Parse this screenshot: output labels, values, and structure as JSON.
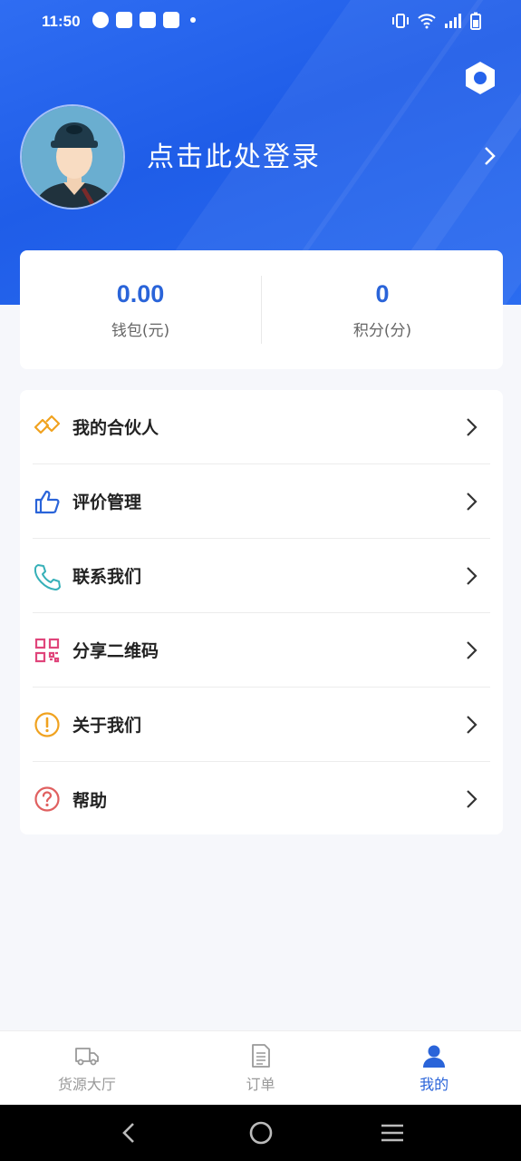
{
  "status_bar": {
    "time": "11:50"
  },
  "header": {
    "login_text": "点击此处登录"
  },
  "stats": [
    {
      "value": "0.00",
      "label": "钱包(元)"
    },
    {
      "value": "0",
      "label": "积分(分)"
    }
  ],
  "menu": [
    {
      "label": "我的合伙人",
      "icon": "partner-icon",
      "color": "#f0a21f"
    },
    {
      "label": "评价管理",
      "icon": "thumb-up-icon",
      "color": "#2a64d9"
    },
    {
      "label": "联系我们",
      "icon": "phone-icon",
      "color": "#36b0b8"
    },
    {
      "label": "分享二维码",
      "icon": "qr-grid-icon",
      "color": "#e0457b"
    },
    {
      "label": "关于我们",
      "icon": "exclamation-circle-icon",
      "color": "#f0a21f"
    },
    {
      "label": "帮助",
      "icon": "question-circle-icon",
      "color": "#e06060"
    }
  ],
  "tabs": [
    {
      "label": "货源大厅",
      "icon": "truck-icon",
      "active": false
    },
    {
      "label": "订单",
      "icon": "document-icon",
      "active": false
    },
    {
      "label": "我的",
      "icon": "person-icon",
      "active": true
    }
  ],
  "colors": {
    "primary": "#2a64d9",
    "header_bg": "#2563eb",
    "page_bg": "#f6f7fb"
  }
}
